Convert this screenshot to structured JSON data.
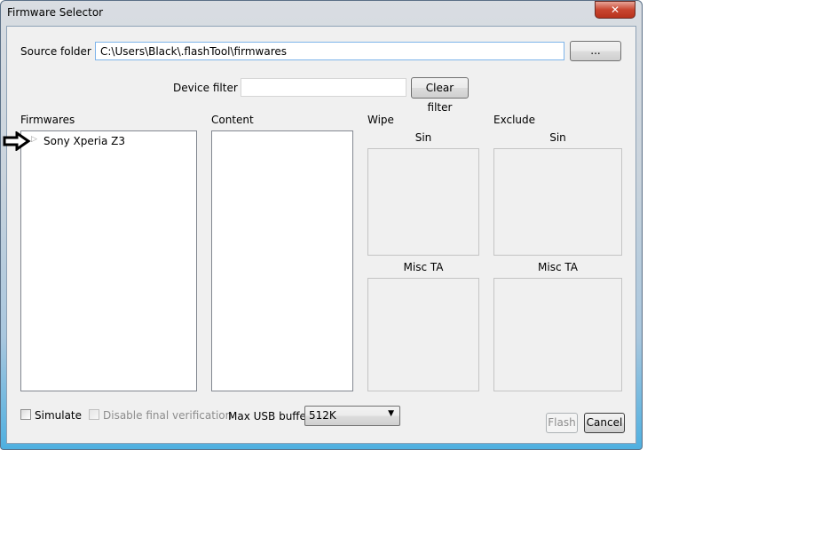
{
  "window": {
    "title": "Firmware Selector",
    "close_icon": "close-icon"
  },
  "source": {
    "label": "Source folder :",
    "value": "C:\\Users\\Black\\.flashTool\\firmwares",
    "browse_label": "..."
  },
  "filter": {
    "label": "Device filter :",
    "value": "",
    "clear_label": "Clear filter"
  },
  "firmwares": {
    "label": "Firmwares",
    "items": [
      {
        "label": "Sony Xperia Z3",
        "expanded": false
      }
    ]
  },
  "content": {
    "label": "Content"
  },
  "wipe": {
    "label": "Wipe",
    "sin": "Sin",
    "misc": "Misc TA"
  },
  "exclude": {
    "label": "Exclude",
    "sin": "Sin",
    "misc": "Misc TA"
  },
  "options": {
    "simulate": "Simulate",
    "simulate_checked": false,
    "disable_verif": "Disable final verification",
    "disable_verif_enabled": false,
    "usb_label": "Max USB buffer",
    "usb_value": "512K"
  },
  "actions": {
    "flash": "Flash",
    "flash_enabled": false,
    "cancel": "Cancel"
  }
}
